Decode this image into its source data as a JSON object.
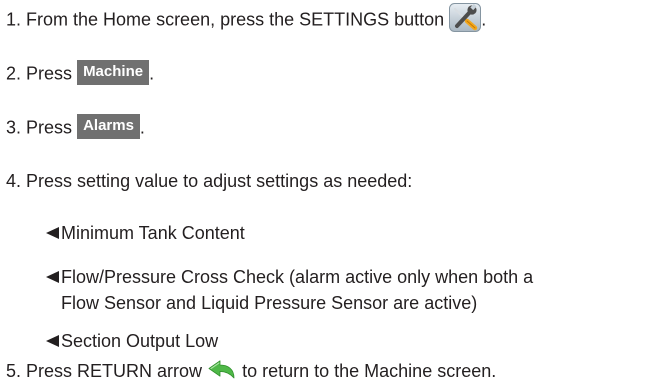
{
  "steps": [
    {
      "num": "1.",
      "text": "From the Home screen, press the SETTINGS button",
      "after": "."
    },
    {
      "num": "2.",
      "before": "Press",
      "button": "Machine",
      "after": "."
    },
    {
      "num": "3.",
      "before": "Press",
      "button": "Alarms",
      "after": "."
    },
    {
      "num": "4.",
      "text": "Press setting value to adjust settings as needed:"
    },
    {
      "num": "5.",
      "before": "Press RETURN arrow",
      "after": "to return to the Machine screen."
    }
  ],
  "bullets": [
    {
      "text": "Minimum Tank Content"
    },
    {
      "text": "Flow/Pressure Cross Check (alarm active only when both a",
      "continuation": "Flow Sensor and Liquid Pressure Sensor are active)"
    },
    {
      "text": "Section Output Low"
    }
  ],
  "icons": {
    "settings": "settings-wrench-screwdriver-icon",
    "return": "return-arrow-icon",
    "bullet": "left-triangle-bullet-icon"
  },
  "colors": {
    "text": "#231f20",
    "button_bg": "#707070",
    "button_text": "#ffffff",
    "return_arrow": "#4fb848"
  }
}
